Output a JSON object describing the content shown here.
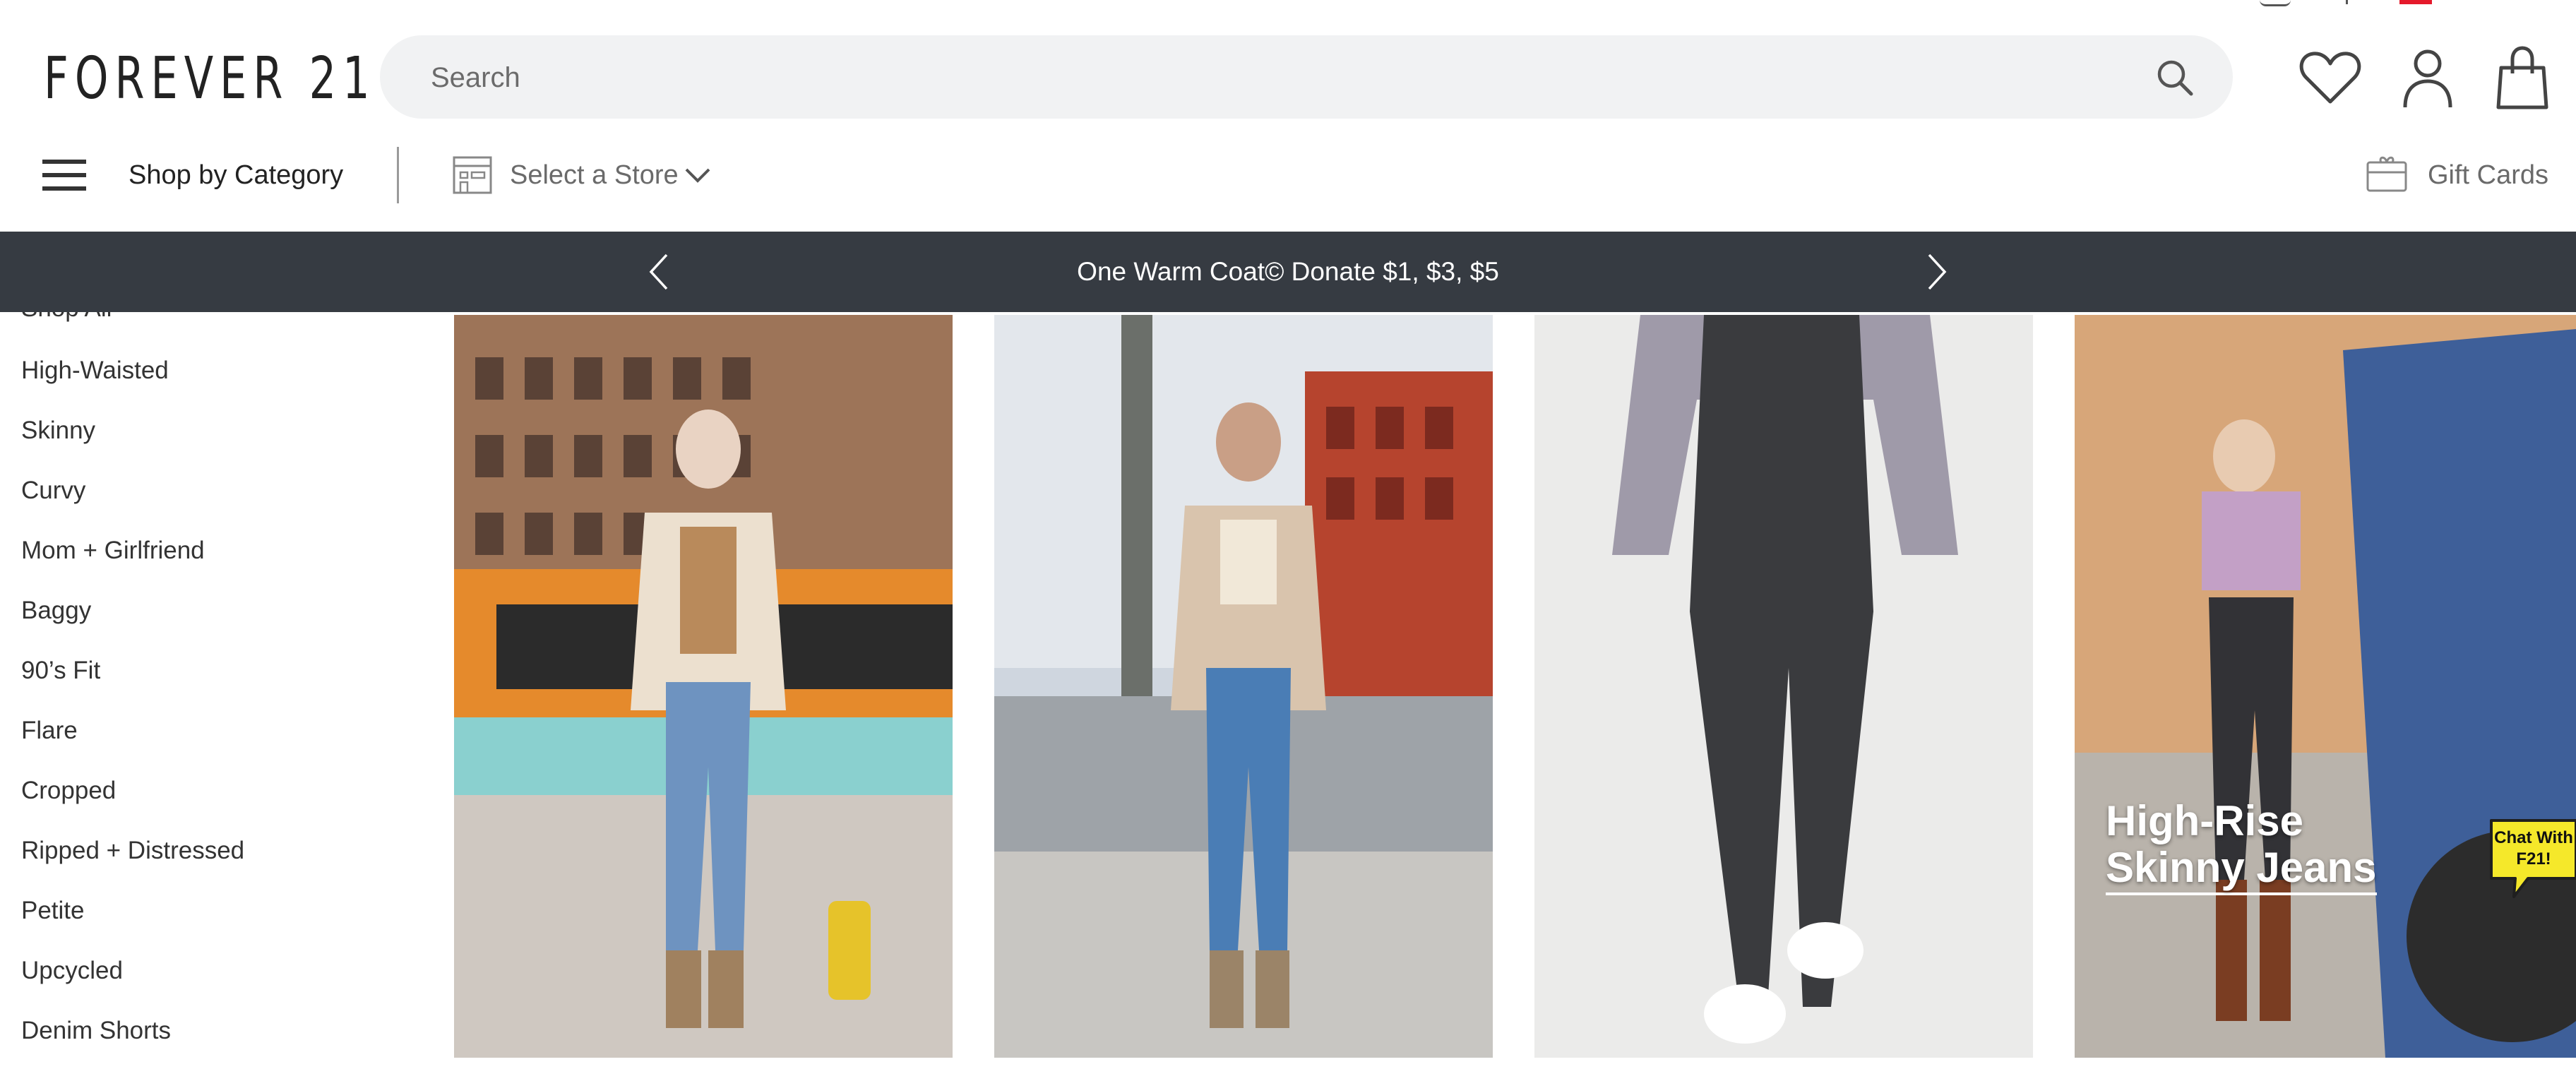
{
  "header": {
    "logo": "FOREVER 21",
    "search": {
      "placeholder": "Search"
    },
    "icons": [
      "heart-icon",
      "account-icon",
      "bag-icon"
    ]
  },
  "nav": {
    "shop_by_category": "Shop by Category",
    "select_store": "Select a Store",
    "gift_cards": "Gift Cards"
  },
  "banner": {
    "text": "One Warm Coat© Donate $1, $3, $5"
  },
  "sidebar": {
    "items": [
      {
        "label": "Shop All"
      },
      {
        "label": "High-Waisted"
      },
      {
        "label": "Skinny"
      },
      {
        "label": "Curvy"
      },
      {
        "label": "Mom + Girlfriend"
      },
      {
        "label": "Baggy"
      },
      {
        "label": "90’s Fit"
      },
      {
        "label": "Flare"
      },
      {
        "label": "Cropped"
      },
      {
        "label": "Ripped + Distressed"
      },
      {
        "label": "Petite"
      },
      {
        "label": "Upcycled"
      },
      {
        "label": "Denim Shorts"
      }
    ]
  },
  "products": [
    {
      "alt": "model in light blue jeans by a bus"
    },
    {
      "alt": "model in blue jeans on street"
    },
    {
      "alt": "black skinny jeans with white sneakers"
    },
    {
      "alt": "model by blue truck",
      "overlay_line1": "High-Rise",
      "overlay_line2": "Skinny Jeans"
    }
  ],
  "chat": {
    "line1": "Chat With",
    "line2": "F21!"
  },
  "colors": {
    "banner_bg": "#363b42",
    "search_bg": "#f1f2f3",
    "chat_yellow": "#f5e82a"
  }
}
